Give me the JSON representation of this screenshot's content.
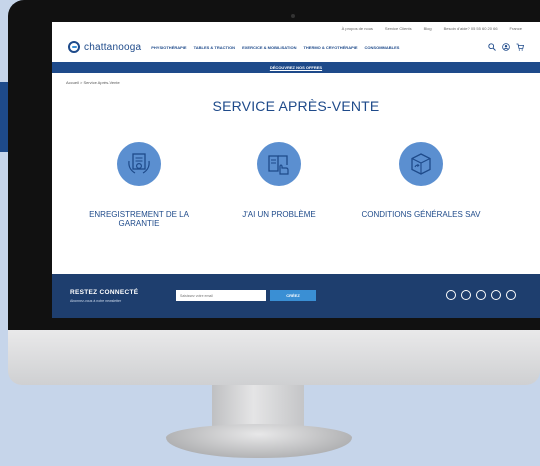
{
  "utility_bar": {
    "links": [
      "À propos de nous",
      "Service Clients",
      "Blog",
      "Besoin d'aide? 05 55 60 20 66",
      "France"
    ]
  },
  "header": {
    "logo_text": "chattanooga",
    "nav": [
      "PHYSIOTHÉRAPIE",
      "TABLES & TRACTION",
      "EXERCICE & MOBILISATION",
      "THERMO & CRYOTHÉRAPIE",
      "CONSOMMABLES"
    ],
    "icons": [
      "search-icon",
      "account-icon",
      "cart-icon"
    ]
  },
  "promo": {
    "label": "DÉCOUVREZ NOS OFFRES"
  },
  "breadcrumb": {
    "text": "Accueil > Service Après-Vente"
  },
  "page": {
    "title": "SERVICE APRÈS-VENTE"
  },
  "tiles": [
    {
      "label": "ENREGISTREMENT DE LA GARANTIE",
      "icon": "certificate-icon"
    },
    {
      "label": "J'AI UN PROBLÈME",
      "icon": "manual-icon"
    },
    {
      "label": "CONDITIONS GÉNÉRALES SAV",
      "icon": "return-box-icon"
    }
  ],
  "footer": {
    "title": "RESTEZ CONNECTÉ",
    "subtitle": "Abonnez-vous à notre newsletter",
    "input_placeholder": "Saisissez votre email",
    "button_label": "CRÉEZ",
    "socials": [
      "facebook-icon",
      "instagram-icon",
      "linkedin-icon",
      "youtube-icon",
      "rss-icon"
    ]
  },
  "colors": {
    "brand_blue": "#1e4a8a",
    "icon_circle": "#5b8fd0",
    "footer_bg": "#1e3e6e",
    "button_blue": "#3a8fd4",
    "page_bg": "#c6d5ea"
  }
}
